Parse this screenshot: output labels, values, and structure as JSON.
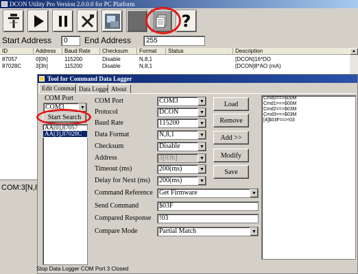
{
  "window": {
    "title": "DCON Utility Pro Version 2.0.0.0 for PC Platform"
  },
  "toolbar": {
    "buttons": [
      {
        "name": "search-module",
        "icon": "search-beam-icon"
      },
      {
        "name": "run",
        "icon": "play-icon"
      },
      {
        "name": "pause",
        "icon": "pause-icon"
      },
      {
        "name": "tools",
        "icon": "tools-icon"
      },
      {
        "name": "terminal",
        "icon": "terminal-icon"
      },
      {
        "name": "blank",
        "icon": ""
      },
      {
        "name": "data-logger",
        "icon": "document-icon"
      },
      {
        "name": "help",
        "icon": "question-icon"
      }
    ],
    "highlight_color": "#e21818"
  },
  "address": {
    "start_label": "Start Address",
    "start_value": "0",
    "end_label": "End Address",
    "end_value": "255"
  },
  "modules": {
    "columns": [
      "ID",
      "Address",
      "Baud Rate",
      "Checksum",
      "Format",
      "Status",
      "Description"
    ],
    "rows": [
      [
        "87057",
        "0[0h]",
        "115200",
        "Disable",
        "N,8,1",
        "",
        "[DCON]16*DO"
      ],
      [
        "87028C",
        "3[3h]",
        "115200",
        "Disable",
        "N,8,1",
        "",
        "[DCON]8*AO (mA)"
      ]
    ]
  },
  "statusbar": {
    "left": "COM:3[N,8"
  },
  "dialog": {
    "title": "Tool for Command Data Logger",
    "tabs": [
      "Edit Command",
      "Data Logger",
      "About"
    ],
    "com_port_label": "COM Port",
    "com_port_value": "COM3",
    "start_search": "Start Search",
    "found_list": [
      "AA[0],87057",
      "AA[3],87028C"
    ],
    "fields": {
      "com_port": {
        "label": "COM Port",
        "value": "COM3"
      },
      "protocol": {
        "label": "Protocol",
        "value": "DCON"
      },
      "baud_rate": {
        "label": "Baud Rate",
        "value": "115200"
      },
      "data_format": {
        "label": "Data Format",
        "value": "N,8,1"
      },
      "checksum": {
        "label": "Checksum",
        "value": "Disable"
      },
      "address": {
        "label": "Address",
        "value": "3[03h]"
      },
      "timeout": {
        "label": "Timeout (ms)",
        "value": "200(ms)"
      },
      "delay": {
        "label": "Delay for Next (ms)",
        "value": "200(ms)"
      },
      "command_reference": {
        "label": "Command Reference",
        "value": "Get Firmware"
      },
      "send_command": {
        "label": "Send Command",
        "value": "$03F"
      },
      "compared_response": {
        "label": "Compared Response",
        "value": "!03"
      },
      "compare_mode": {
        "label": "Compare Mode",
        "value": "Partial Match"
      }
    },
    "buttons": {
      "load": "Load",
      "remove": "Remove",
      "add": "Add >>",
      "modify": "Modify",
      "save": "Save"
    },
    "command_log": [
      "Cmd0==>$00M",
      "Cmd1==>$00M",
      "Cmd2==>$03M",
      "Cmd3==>$03M",
      "[4]$03F==>!03"
    ],
    "status": "Stop Data Logger COM Port 3 Closed"
  }
}
